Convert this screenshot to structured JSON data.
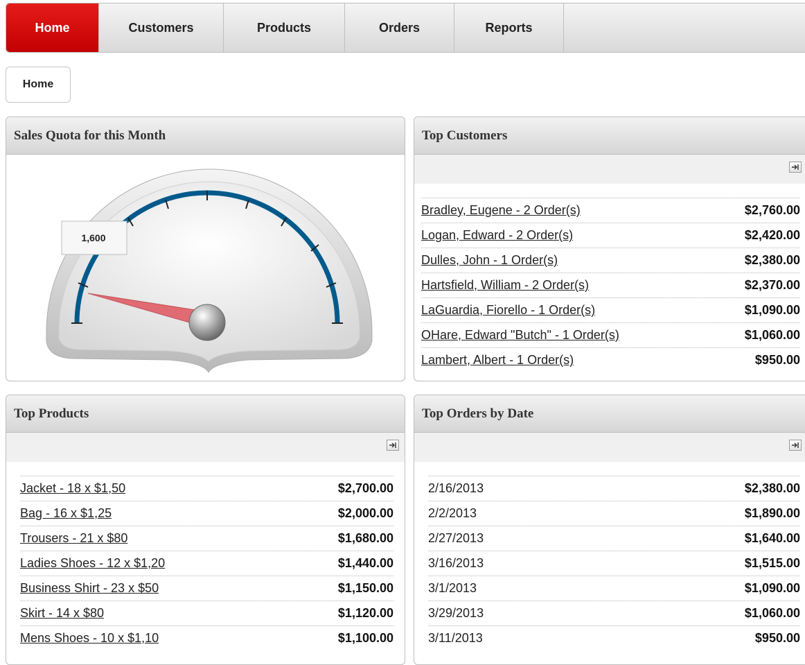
{
  "nav": {
    "tabs": [
      {
        "label": "Home",
        "active": true
      },
      {
        "label": "Customers",
        "active": false
      },
      {
        "label": "Products",
        "active": false
      },
      {
        "label": "Orders",
        "active": false
      },
      {
        "label": "Reports",
        "active": false
      }
    ]
  },
  "breadcrumb": {
    "label": "Home"
  },
  "sales_quota": {
    "title": "Sales Quota for this Month",
    "value_label": "1,600"
  },
  "top_customers": {
    "title": "Top Customers",
    "rows": [
      {
        "label": "Bradley, Eugene - 2 Order(s)",
        "amount": "$2,760.00"
      },
      {
        "label": "Logan, Edward - 2 Order(s)",
        "amount": "$2,420.00"
      },
      {
        "label": "Dulles, John - 1 Order(s)",
        "amount": "$2,380.00"
      },
      {
        "label": "Hartsfield, William - 2 Order(s)",
        "amount": "$2,370.00"
      },
      {
        "label": "LaGuardia, Fiorello - 1 Order(s)",
        "amount": "$1,090.00"
      },
      {
        "label": "OHare, Edward \"Butch\" - 1 Order(s)",
        "amount": "$1,060.00"
      },
      {
        "label": "Lambert, Albert - 1 Order(s)",
        "amount": "$950.00"
      }
    ]
  },
  "top_products": {
    "title": "Top Products",
    "rows": [
      {
        "label": "Jacket - 18 x $1,50",
        "amount": "$2,700.00"
      },
      {
        "label": "Bag - 16 x $1,25",
        "amount": "$2,000.00"
      },
      {
        "label": "Trousers - 21 x $80",
        "amount": "$1,680.00"
      },
      {
        "label": "Ladies Shoes - 12 x $1,20",
        "amount": "$1,440.00"
      },
      {
        "label": "Business Shirt - 23 x $50",
        "amount": "$1,150.00"
      },
      {
        "label": "Skirt - 14 x $80",
        "amount": "$1,120.00"
      },
      {
        "label": "Mens Shoes - 10 x $1,10",
        "amount": "$1,100.00"
      }
    ]
  },
  "top_orders": {
    "title": "Top Orders by Date",
    "rows": [
      {
        "label": "2/16/2013",
        "amount": "$2,380.00"
      },
      {
        "label": "2/2/2013",
        "amount": "$1,890.00"
      },
      {
        "label": "2/27/2013",
        "amount": "$1,640.00"
      },
      {
        "label": "3/16/2013",
        "amount": "$1,515.00"
      },
      {
        "label": "3/1/2013",
        "amount": "$1,090.00"
      },
      {
        "label": "3/29/2013",
        "amount": "$1,060.00"
      },
      {
        "label": "3/11/2013",
        "amount": "$950.00"
      }
    ]
  },
  "colors": {
    "active_tab": "#d40c0c",
    "gauge_arc": "#005a8c",
    "gauge_needle": "#e06b72"
  },
  "icons": {
    "expand": "arrow-right-icon"
  }
}
